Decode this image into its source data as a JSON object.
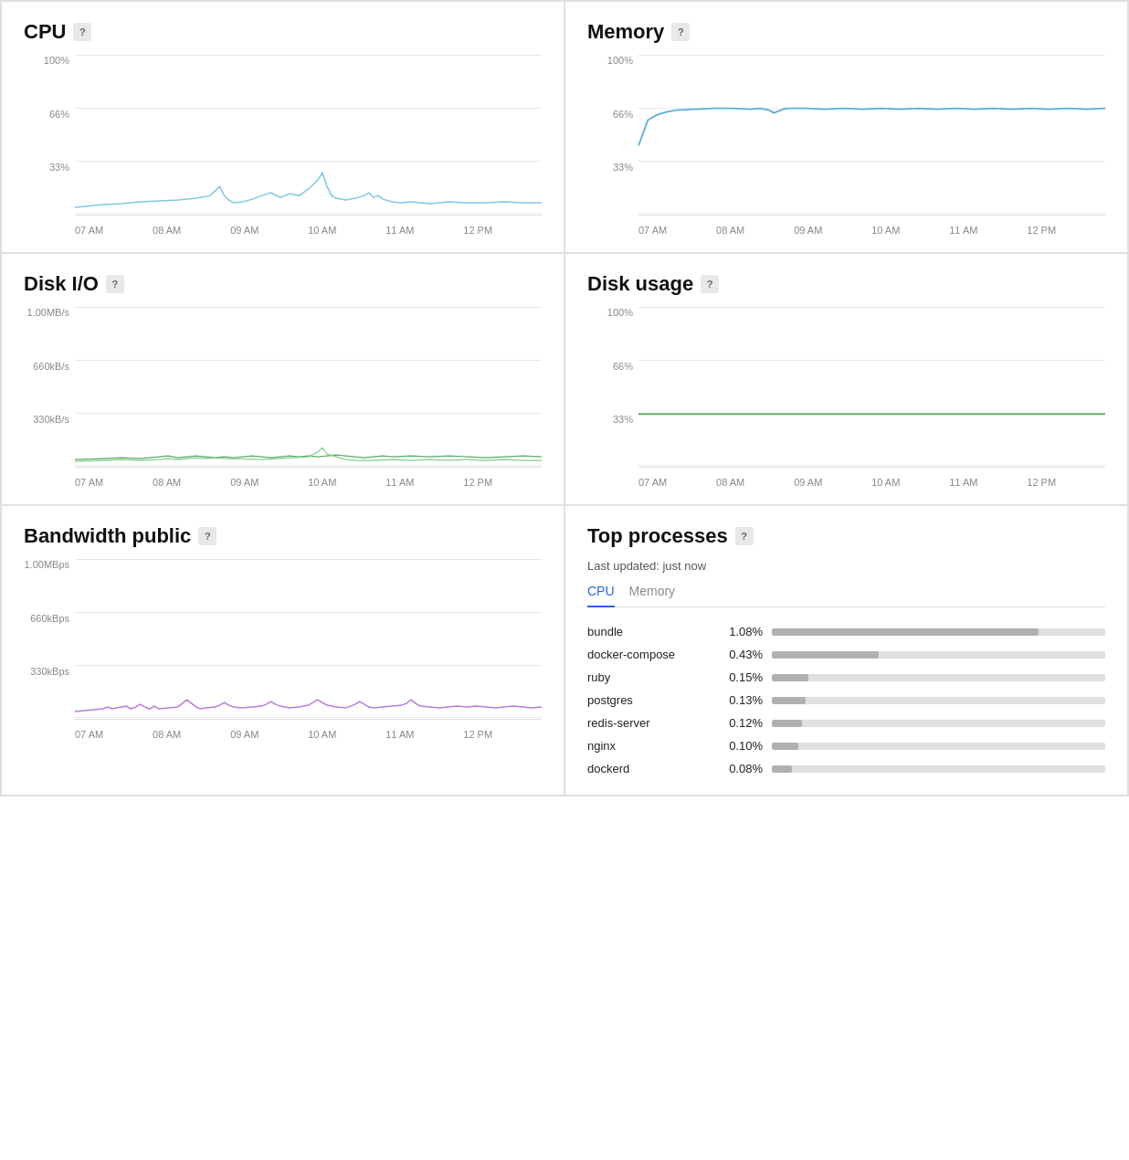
{
  "panels": {
    "cpu": {
      "title": "CPU",
      "help": "?",
      "y_labels": [
        "100%",
        "66%",
        "33%",
        ""
      ],
      "x_labels": [
        "07 AM",
        "08 AM",
        "09 AM",
        "10 AM",
        "11 AM",
        "12 PM",
        ""
      ],
      "color": "#7ec8e3",
      "type": "cpu"
    },
    "memory": {
      "title": "Memory",
      "help": "?",
      "y_labels": [
        "100%",
        "66%",
        "33%",
        ""
      ],
      "x_labels": [
        "07 AM",
        "08 AM",
        "09 AM",
        "10 AM",
        "11 AM",
        "12 PM",
        ""
      ],
      "color": "#5bafd6",
      "type": "memory"
    },
    "disk_io": {
      "title": "Disk I/O",
      "help": "?",
      "y_labels": [
        "1.00MB/s",
        "660kB/s",
        "330kB/s",
        ""
      ],
      "x_labels": [
        "07 AM",
        "08 AM",
        "09 AM",
        "10 AM",
        "11 AM",
        "12 PM",
        ""
      ],
      "color": "#6dbf7a",
      "type": "diskio"
    },
    "disk_usage": {
      "title": "Disk usage",
      "help": "?",
      "y_labels": [
        "100%",
        "66%",
        "33%",
        ""
      ],
      "x_labels": [
        "07 AM",
        "08 AM",
        "09 AM",
        "10 AM",
        "11 AM",
        "12 PM",
        ""
      ],
      "color": "#4caf50",
      "type": "diskusage"
    },
    "bandwidth": {
      "title": "Bandwidth public",
      "help": "?",
      "y_labels": [
        "1.00MBps",
        "660kBps",
        "330kBps",
        ""
      ],
      "x_labels": [
        "07 AM",
        "08 AM",
        "09 AM",
        "10 AM",
        "11 AM",
        "12 PM",
        ""
      ],
      "color": "#b57cdc",
      "type": "bandwidth"
    }
  },
  "top_processes": {
    "title": "Top processes",
    "help": "?",
    "last_updated": "Last updated: just now",
    "tabs": [
      "CPU",
      "Memory"
    ],
    "active_tab": "CPU",
    "processes": [
      {
        "name": "bundle",
        "pct": "1.08%",
        "bar": 80
      },
      {
        "name": "docker-compose",
        "pct": "0.43%",
        "bar": 32
      },
      {
        "name": "ruby",
        "pct": "0.15%",
        "bar": 11
      },
      {
        "name": "postgres",
        "pct": "0.13%",
        "bar": 10
      },
      {
        "name": "redis-server",
        "pct": "0.12%",
        "bar": 9
      },
      {
        "name": "nginx",
        "pct": "0.10%",
        "bar": 8
      },
      {
        "name": "dockerd",
        "pct": "0.08%",
        "bar": 6
      }
    ]
  }
}
